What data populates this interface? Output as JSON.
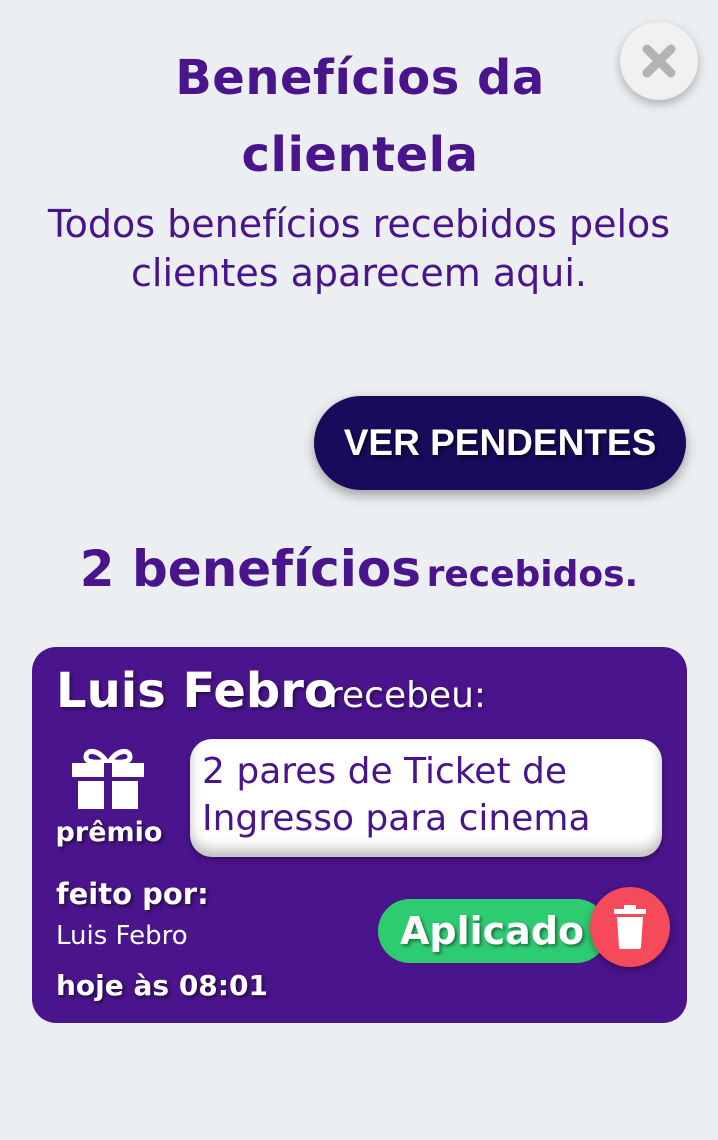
{
  "header": {
    "title": "Benefícios da clientela",
    "subtitle": "Todos benefícios recebidos pelos clientes aparecem aqui.",
    "close_icon": "close-icon"
  },
  "actions": {
    "pending_label": "VER PENDENTES"
  },
  "summary": {
    "count_big": "2 benefícios",
    "count_small": "recebidos."
  },
  "benefits": [
    {
      "customer_name": "Luis Febro",
      "received_text": "recebeu:",
      "type_icon": "gift-icon",
      "type_label": "prêmio",
      "prize_text": "2 pares de Ticket de Ingresso para cinema",
      "made_by_label": "feito por:",
      "made_by_name": "Luis Febro",
      "timestamp": "hoje às 08:01",
      "status": "Aplicado",
      "delete_icon": "trash-icon"
    }
  ],
  "colors": {
    "background": "#eceff1",
    "primary_purple": "#4a148c",
    "button_dark": "#1a0a5c",
    "status_green": "#2ecc71",
    "delete_red": "#f44a5a"
  }
}
